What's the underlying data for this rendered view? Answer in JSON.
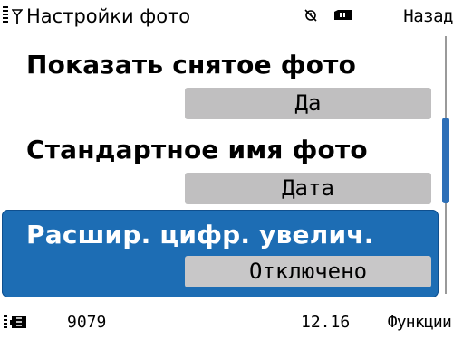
{
  "header": {
    "title": "Настройки фото",
    "back_label": "Назад",
    "icons": [
      "signal-icon",
      "antenna-icon",
      "alarm-icon",
      "memory-card-icon"
    ]
  },
  "settings": [
    {
      "label": "Показать снятое фото",
      "value": "Да"
    },
    {
      "label": "Стандартное имя фото",
      "value": "Дата"
    },
    {
      "label": "Расшир. цифр. увелич.",
      "value": "Отключено",
      "selected": true
    }
  ],
  "footer": {
    "counter": "9079",
    "time": "12.16",
    "functions_label": "Функции",
    "icons": [
      "battery-icon"
    ]
  },
  "colors": {
    "selection": "#1d6db4",
    "value_box": "#c0bfc0",
    "scroll_thumb": "#2d6fb7"
  }
}
